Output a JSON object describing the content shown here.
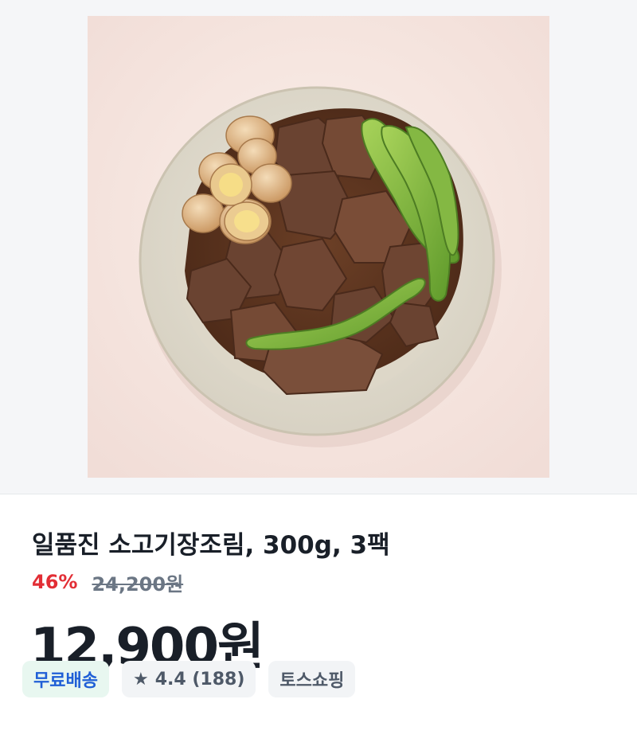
{
  "product": {
    "image_alt": "beef jangjorim with quail eggs and shishito peppers",
    "title": "일품진 소고기장조림, 300g, 3팩",
    "discount": "46%",
    "original_price": "24,200원",
    "price": "12,900원"
  },
  "chips": {
    "shipping": "무료배송",
    "rating": "4.4 (188)",
    "seller": "토스쇼핑"
  },
  "colors": {
    "discount": "#e22e35",
    "shipping_text": "#1f5fd6",
    "shipping_bg": "#e8f7f0",
    "chip_bg": "#f2f4f6"
  },
  "icons": {
    "rating": "star-icon"
  }
}
